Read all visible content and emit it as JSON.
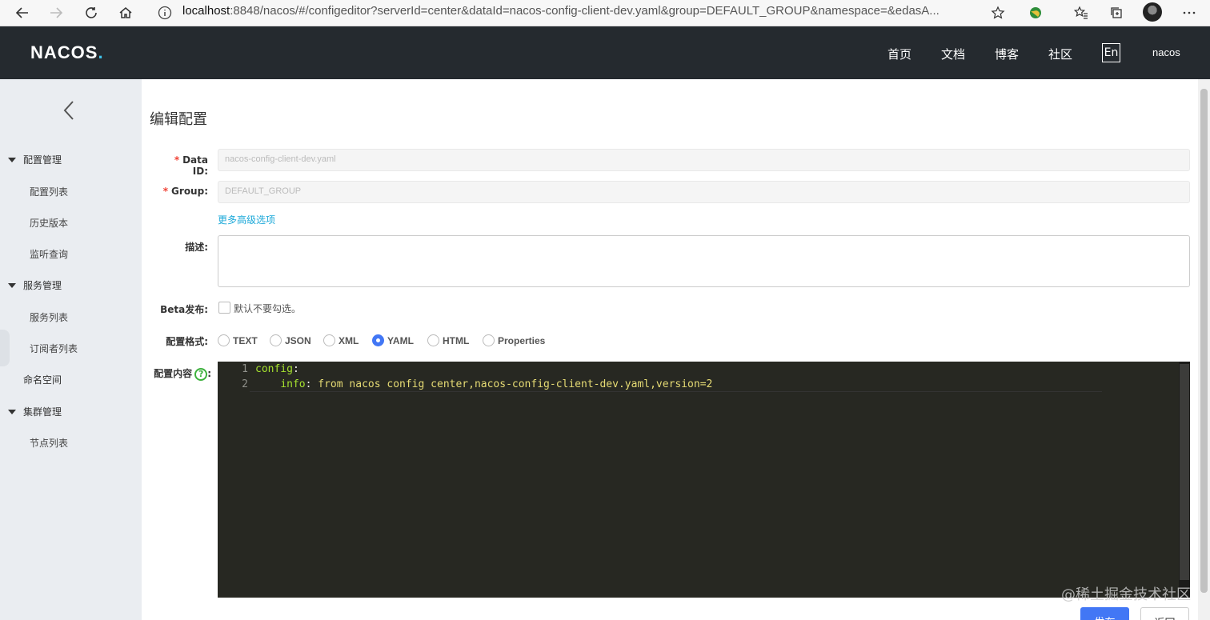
{
  "browser": {
    "url_host": "localhost",
    "url_rest": ":8848/nacos/#/configeditor?serverId=center&dataId=nacos-config-client-dev.yaml&group=DEFAULT_GROUP&namespace=&edasA..."
  },
  "header": {
    "logo_main": "NACOS",
    "logo_dot": ".",
    "nav": [
      "首页",
      "文档",
      "博客",
      "社区"
    ],
    "lang": "En",
    "user": "nacos"
  },
  "sidebar": {
    "groups": [
      {
        "label": "配置管理",
        "items": [
          "配置列表",
          "历史版本",
          "监听查询"
        ]
      },
      {
        "label": "服务管理",
        "items": [
          "服务列表",
          "订阅者列表"
        ]
      },
      {
        "label": "命名空间"
      },
      {
        "label": "集群管理",
        "items": [
          "节点列表"
        ]
      }
    ]
  },
  "form": {
    "title": "编辑配置",
    "data_id_label": "Data ID:",
    "data_id_value": "nacos-config-client-dev.yaml",
    "group_label": "Group:",
    "group_value": "DEFAULT_GROUP",
    "advanced_link": "更多高级选项",
    "desc_label": "描述:",
    "beta_label": "Beta发布:",
    "beta_hint": "默认不要勾选。",
    "format_label": "配置格式:",
    "formats": [
      "TEXT",
      "JSON",
      "XML",
      "YAML",
      "HTML",
      "Properties"
    ],
    "selected_format": "YAML",
    "content_label": "配置内容",
    "help_glyph": "?",
    "colon": ":",
    "required_mark": "*"
  },
  "editor": {
    "line_numbers": [
      "1",
      "2"
    ],
    "line1_key": "config",
    "line1_colon": ":",
    "line2_indent": "    ",
    "line2_key": "info",
    "line2_colon": ": ",
    "line2_value": "from nacos config center,nacos-config-client-dev.yaml,version=2"
  },
  "actions": {
    "publish": "发布",
    "back": "返回"
  },
  "watermark": "@稀土掘金技术社区"
}
